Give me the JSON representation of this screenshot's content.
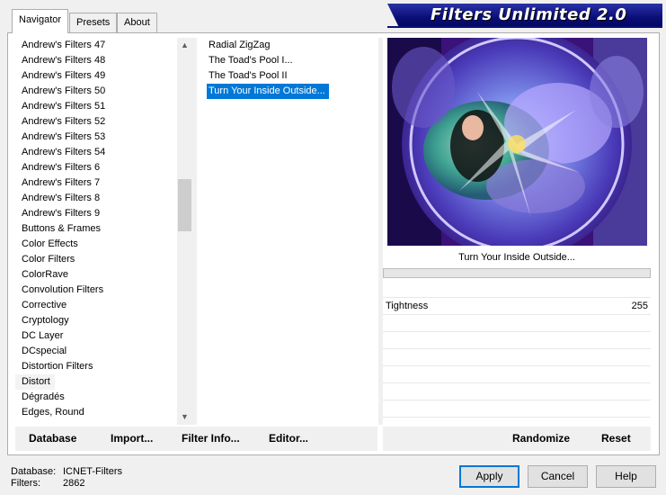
{
  "tabs": [
    {
      "label": "Navigator",
      "active": true
    },
    {
      "label": "Presets",
      "active": false
    },
    {
      "label": "About",
      "active": false
    }
  ],
  "banner": {
    "title": "Filters Unlimited 2.0"
  },
  "categories": [
    "Andrew's Filters 47",
    "Andrew's Filters 48",
    "Andrew's Filters 49",
    "Andrew's Filters 50",
    "Andrew's Filters 51",
    "Andrew's Filters 52",
    "Andrew's Filters 53",
    "Andrew's Filters 54",
    "Andrew's Filters 6",
    "Andrew's Filters 7",
    "Andrew's Filters 8",
    "Andrew's Filters 9",
    "Buttons & Frames",
    "Color Effects",
    "Color Filters",
    "ColorRave",
    "Convolution Filters",
    "Corrective",
    "Cryptology",
    "DC Layer",
    "DCspecial",
    "Distortion Filters",
    "Distort",
    "Dégradés",
    "Edges, Round"
  ],
  "selected_category": "Distort",
  "filters": [
    "Radial ZigZag",
    "The Toad's Pool I...",
    "The Toad's Pool II",
    "Turn Your Inside Outside..."
  ],
  "selected_filter": "Turn Your Inside Outside...",
  "preview": {
    "filter_title": "Turn Your Inside Outside..."
  },
  "params": [
    {
      "name": "Tightness",
      "value": "255"
    }
  ],
  "left_buttons": {
    "database": "Database",
    "import": "Import...",
    "filter_info": "Filter Info...",
    "editor": "Editor..."
  },
  "right_buttons": {
    "randomize": "Randomize",
    "reset": "Reset"
  },
  "footer": {
    "database_label": "Database:",
    "database_value": "ICNET-Filters",
    "filters_label": "Filters:",
    "filters_value": "2862"
  },
  "dialog_buttons": {
    "apply": "Apply",
    "cancel": "Cancel",
    "help": "Help"
  },
  "colors": {
    "selection": "#0078d7",
    "banner": "#0a0f78"
  }
}
